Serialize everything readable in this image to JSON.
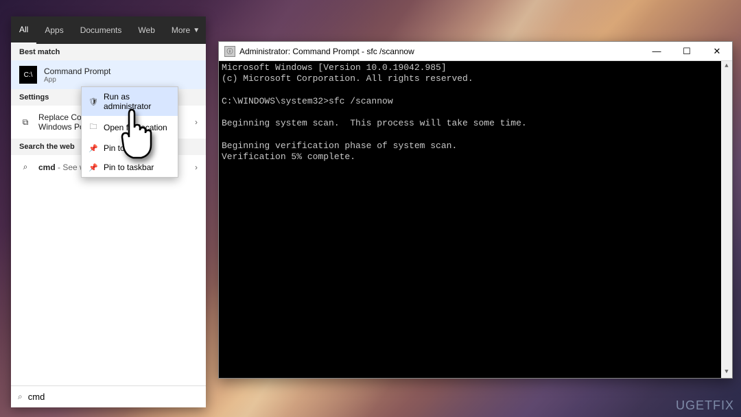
{
  "tabs": {
    "all": "All",
    "apps": "Apps",
    "documents": "Documents",
    "web": "Web",
    "more": "More"
  },
  "sections": {
    "best_match": "Best match",
    "settings": "Settings",
    "search_web": "Search the web"
  },
  "result": {
    "title": "Command Prompt",
    "subtitle": "App"
  },
  "settings_item": {
    "line1": "Replace Command Prompt with",
    "line2": "Windows PowerShell..."
  },
  "web_item": {
    "prefix": "cmd",
    "suffix": "- See web results"
  },
  "context_menu": {
    "run_admin": "Run as administrator",
    "open_loc": "Open file location",
    "pin_start": "Pin to Start",
    "pin_taskbar": "Pin to taskbar"
  },
  "search": {
    "value": "cmd"
  },
  "cmd": {
    "title": "Administrator: Command Prompt - sfc  /scannow",
    "lines": [
      "Microsoft Windows [Version 10.0.19042.985]",
      "(c) Microsoft Corporation. All rights reserved.",
      "",
      "C:\\WINDOWS\\system32>sfc /scannow",
      "",
      "Beginning system scan.  This process will take some time.",
      "",
      "Beginning verification phase of system scan.",
      "Verification 5% complete."
    ]
  },
  "watermark": "UGETFIX"
}
